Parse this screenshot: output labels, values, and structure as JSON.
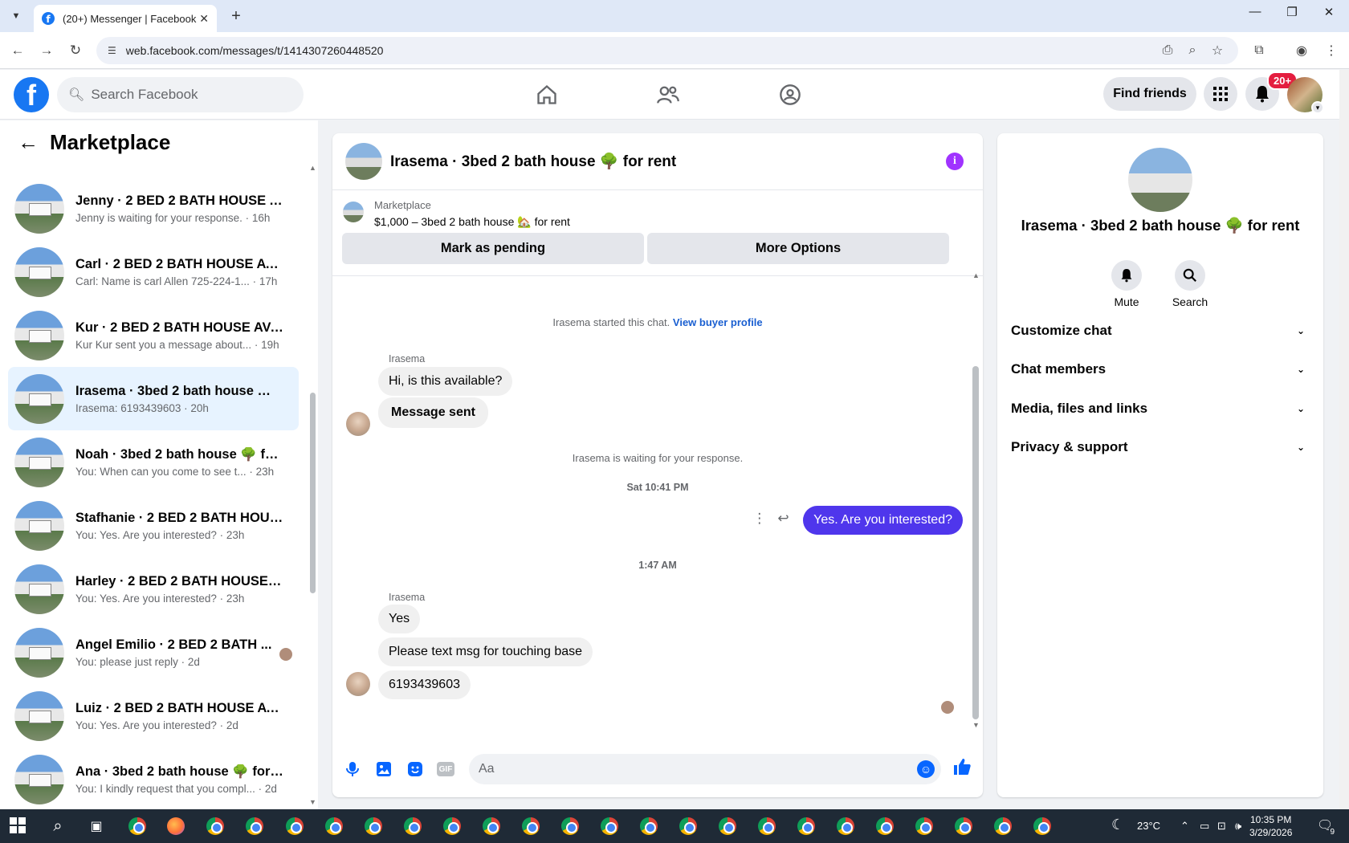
{
  "browser": {
    "tab_title": "(20+) Messenger | Facebook",
    "url": "web.facebook.com/messages/t/1414307260448520"
  },
  "header": {
    "search_placeholder": "Search Facebook",
    "find_friends": "Find friends",
    "notification_badge": "20+"
  },
  "sidebar": {
    "title": "Marketplace",
    "conversations": [
      {
        "name": "Jenny · 2 BED 2 BATH HOUSE AV...",
        "preview": "Jenny is waiting for your response. · 16h",
        "active": false
      },
      {
        "name": "Carl · 2 BED 2 BATH HOUSE AVAI...",
        "preview": "Carl: Name is carl Allen 725-224-1... · 17h",
        "active": false
      },
      {
        "name": "Kur · 2 BED 2 BATH HOUSE AVAI...",
        "preview": "Kur Kur sent you a message about... · 19h",
        "active": false
      },
      {
        "name": "Irasema · 3bed 2 bath house 🌳 ...",
        "preview": "Irasema: 6193439603 · 20h",
        "active": true
      },
      {
        "name": "Noah · 3bed 2 bath house 🌳 for...",
        "preview": "You: When can you come to see t... · 23h",
        "active": false
      },
      {
        "name": "Stafhanie · 2 BED 2 BATH HOUS...",
        "preview": "You: Yes. Are you interested? · 23h",
        "active": false
      },
      {
        "name": "Harley · 2 BED 2 BATH HOUSE A...",
        "preview": "You: Yes. Are you interested? · 23h",
        "active": false
      },
      {
        "name": "Angel Emilio · 2 BED 2 BATH ...",
        "preview": "You: please just reply · 2d",
        "active": false
      },
      {
        "name": "Luiz · 2 BED 2 BATH HOUSE AVA...",
        "preview": "You: Yes. Are you interested? · 2d",
        "active": false
      },
      {
        "name": "Ana · 3bed 2 bath house 🌳 for r...",
        "preview": "You: I kindly request that you compl... · 2d",
        "active": false
      }
    ]
  },
  "chat": {
    "title": "Irasema · 3bed 2 bath house 🌳 for rent",
    "marketplace_label": "Marketplace",
    "listing_line": "$1,000 – 3bed 2 bath house 🏡 for rent",
    "mark_pending": "Mark as pending",
    "more_options": "More Options",
    "started_text": "Irasema started this chat.",
    "view_profile": "View buyer profile",
    "sender_name": "Irasema",
    "msg1": "Hi, is this available?",
    "msg2": "Message sent",
    "waiting_text": "Irasema is waiting for your response.",
    "ts1": "Sat 10:41 PM",
    "out_msg": "Yes. Are you interested?",
    "ts2": "1:47 AM",
    "msg3": "Yes",
    "msg4": "Please text msg for touching base",
    "msg5": "6193439603",
    "composer_placeholder": "Aa"
  },
  "info_panel": {
    "name": "Irasema · 3bed 2 bath house 🌳 for rent",
    "mute": "Mute",
    "search": "Search",
    "rows": [
      "Customize chat",
      "Chat members",
      "Media, files and links",
      "Privacy & support"
    ]
  },
  "taskbar": {
    "temperature": "23°C",
    "time": "10:35 PM",
    "date": "3/29/2026",
    "notif_count": "9"
  },
  "colors": {
    "fb_blue": "#1877f2",
    "outgoing_bubble": "#4f36ec",
    "active_conv": "#e7f3ff"
  }
}
